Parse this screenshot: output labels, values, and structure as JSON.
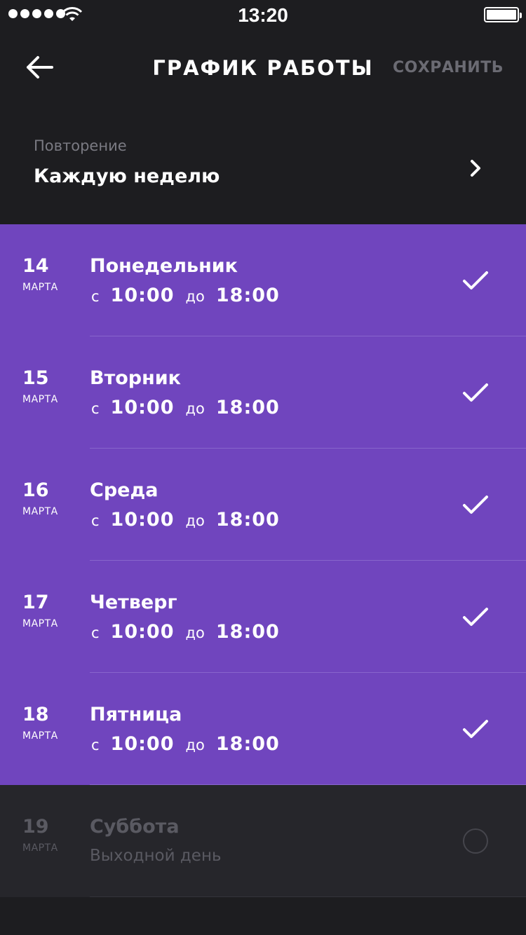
{
  "status_bar": {
    "time": "13:20"
  },
  "nav": {
    "back_icon": "arrow-left-icon",
    "title": "ГРАФИК РАБОТЫ",
    "save_label": "СОХРАНИТЬ"
  },
  "repeat": {
    "label": "Повторение",
    "value": "Каждую неделю"
  },
  "days": [
    {
      "day": "14",
      "month": "МАРТА",
      "name": "Понедельник",
      "from_prefix": "с",
      "from": "10:00",
      "to_prefix": "до",
      "to": "18:00",
      "checked": true
    },
    {
      "day": "15",
      "month": "МАРТА",
      "name": "Вторник",
      "from_prefix": "с",
      "from": "10:00",
      "to_prefix": "до",
      "to": "18:00",
      "checked": true
    },
    {
      "day": "16",
      "month": "МАРТА",
      "name": "Среда",
      "from_prefix": "с",
      "from": "10:00",
      "to_prefix": "до",
      "to": "18:00",
      "checked": true
    },
    {
      "day": "17",
      "month": "МАРТА",
      "name": "Четверг",
      "from_prefix": "с",
      "from": "10:00",
      "to_prefix": "до",
      "to": "18:00",
      "checked": true
    },
    {
      "day": "18",
      "month": "МАРТА",
      "name": "Пятница",
      "from_prefix": "с",
      "from": "10:00",
      "to_prefix": "до",
      "to": "18:00",
      "checked": true
    },
    {
      "day": "19",
      "month": "МАРТА",
      "name": "Суббота",
      "subtitle": "Выходной день",
      "checked": false
    }
  ],
  "colors": {
    "background": "#1d1d20",
    "active_row": "#7045be",
    "inactive_row": "#26262b",
    "muted_text": "#5a5a62"
  }
}
